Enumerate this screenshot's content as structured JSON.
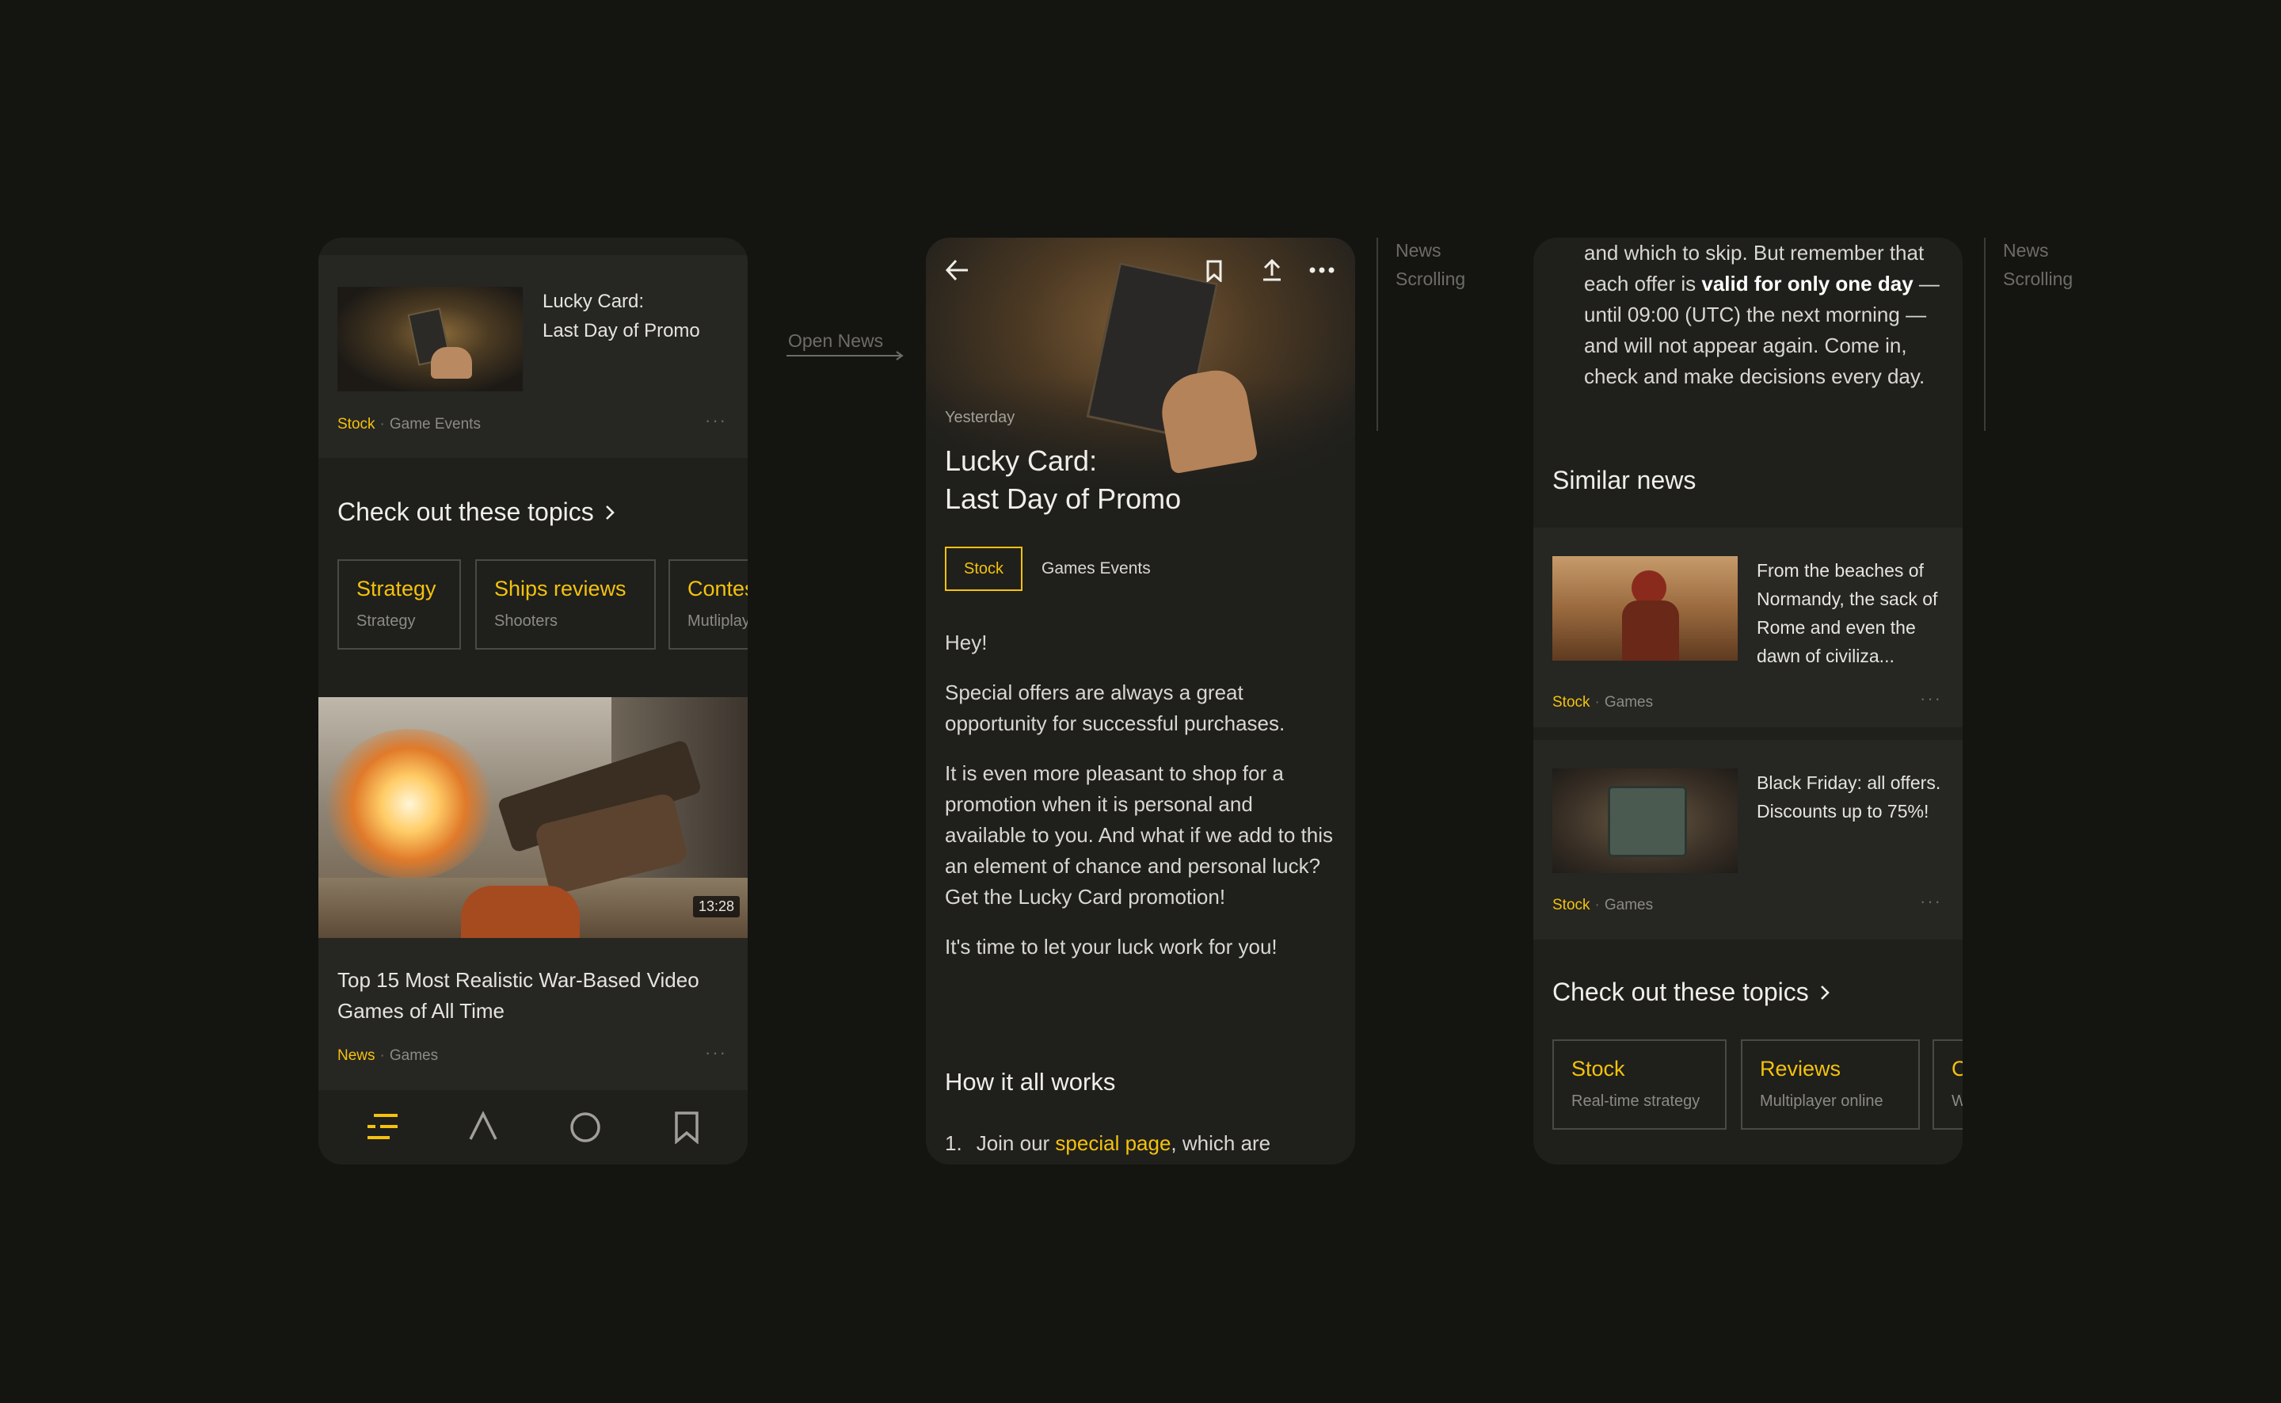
{
  "annotations": {
    "open_news": "Open News",
    "news_scrolling_1": "News\nScrolling",
    "news_scrolling_2": "News\nScrolling"
  },
  "feed": {
    "top_card": {
      "title_line1": "Lucky Card:",
      "title_line2": "Last Day of Promo",
      "tag": "Stock",
      "category": "Game Events",
      "more": "···"
    },
    "topics_heading": "Check out these topics",
    "topics": [
      {
        "title": "Strategy",
        "subtitle": "Strategy"
      },
      {
        "title": "Ships reviews",
        "subtitle": "Shooters"
      },
      {
        "title": "Contests",
        "subtitle": "Mutliplayer"
      }
    ],
    "video_card": {
      "duration": "13:28",
      "title": "Top 15 Most Realistic War-Based Video Games of All Time",
      "tag": "News",
      "category": "Games",
      "more": "···"
    },
    "nav": [
      "menu-icon",
      "explore-icon",
      "circle-icon",
      "bookmark-icon"
    ]
  },
  "article": {
    "date": "Yesterday",
    "title_line1": "Lucky Card:",
    "title_line2": "Last Day of Promo",
    "tag_active": "Stock",
    "tag_other": "Games Events",
    "paragraphs": [
      "Hey!",
      "Special offers are always a great opportunity for successful purchases.",
      "It is even more pleasant to shop for a promotion when it is personal and available to you. And what if we add to this an element of chance and personal luck? Get the Lucky Card promotion!",
      "It's time to let your luck work for you!"
    ],
    "how_heading": "How it all works",
    "step1_num": "1.",
    "step1_before": "Join our ",
    "step1_link": "special page",
    "step1_after": ", which are"
  },
  "scrolled": {
    "text_before": "and which to skip. But remember that each offer is ",
    "text_bold": "valid for only one day",
    "text_after": " — until 09:00 (UTC) the next morning — and will not appear again. Come in, check and make decisions every day.",
    "similar_heading": "Similar news",
    "similar": [
      {
        "title": "From the beaches of Normandy, the sack of Rome and even the dawn of civiliza...",
        "tag": "Stock",
        "category": "Games",
        "more": "···"
      },
      {
        "title": "Black Friday: all offers. Discounts up to 75%!",
        "tag": "Stock",
        "category": "Games",
        "more": "···"
      }
    ],
    "topics_heading": "Check out these topics",
    "topics": [
      {
        "title": "Stock",
        "subtitle": "Real-time strategy"
      },
      {
        "title": "Reviews",
        "subtitle": "Multiplayer online"
      },
      {
        "title": "Contests",
        "subtitle": "Wargames"
      }
    ]
  },
  "colors": {
    "accent": "#f4c20d",
    "background": "#141411",
    "surface": "#1f1f1c",
    "card": "#262623"
  }
}
